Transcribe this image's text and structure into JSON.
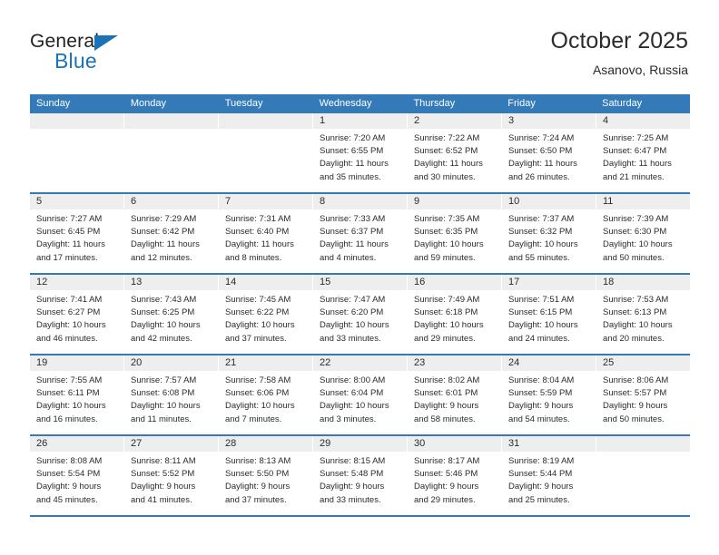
{
  "logo": {
    "word_top": "General",
    "word_bottom": "Blue",
    "accent_color": "#1b72b8"
  },
  "header": {
    "title": "October 2025",
    "subtitle": "Asanovo, Russia"
  },
  "theme": {
    "header_blue": "#3479b8",
    "day_strip_gray": "#eeeeee",
    "text_color": "#2b2b2b"
  },
  "calendar": {
    "weekdays": [
      "Sunday",
      "Monday",
      "Tuesday",
      "Wednesday",
      "Thursday",
      "Friday",
      "Saturday"
    ],
    "weeks": [
      [
        {
          "day": "",
          "empty": true,
          "lines": []
        },
        {
          "day": "",
          "empty": true,
          "lines": []
        },
        {
          "day": "",
          "empty": true,
          "lines": []
        },
        {
          "day": "1",
          "empty": false,
          "lines": [
            "Sunrise: 7:20 AM",
            "Sunset: 6:55 PM",
            "Daylight: 11 hours",
            "and 35 minutes."
          ]
        },
        {
          "day": "2",
          "empty": false,
          "lines": [
            "Sunrise: 7:22 AM",
            "Sunset: 6:52 PM",
            "Daylight: 11 hours",
            "and 30 minutes."
          ]
        },
        {
          "day": "3",
          "empty": false,
          "lines": [
            "Sunrise: 7:24 AM",
            "Sunset: 6:50 PM",
            "Daylight: 11 hours",
            "and 26 minutes."
          ]
        },
        {
          "day": "4",
          "empty": false,
          "lines": [
            "Sunrise: 7:25 AM",
            "Sunset: 6:47 PM",
            "Daylight: 11 hours",
            "and 21 minutes."
          ]
        }
      ],
      [
        {
          "day": "5",
          "empty": false,
          "lines": [
            "Sunrise: 7:27 AM",
            "Sunset: 6:45 PM",
            "Daylight: 11 hours",
            "and 17 minutes."
          ]
        },
        {
          "day": "6",
          "empty": false,
          "lines": [
            "Sunrise: 7:29 AM",
            "Sunset: 6:42 PM",
            "Daylight: 11 hours",
            "and 12 minutes."
          ]
        },
        {
          "day": "7",
          "empty": false,
          "lines": [
            "Sunrise: 7:31 AM",
            "Sunset: 6:40 PM",
            "Daylight: 11 hours",
            "and 8 minutes."
          ]
        },
        {
          "day": "8",
          "empty": false,
          "lines": [
            "Sunrise: 7:33 AM",
            "Sunset: 6:37 PM",
            "Daylight: 11 hours",
            "and 4 minutes."
          ]
        },
        {
          "day": "9",
          "empty": false,
          "lines": [
            "Sunrise: 7:35 AM",
            "Sunset: 6:35 PM",
            "Daylight: 10 hours",
            "and 59 minutes."
          ]
        },
        {
          "day": "10",
          "empty": false,
          "lines": [
            "Sunrise: 7:37 AM",
            "Sunset: 6:32 PM",
            "Daylight: 10 hours",
            "and 55 minutes."
          ]
        },
        {
          "day": "11",
          "empty": false,
          "lines": [
            "Sunrise: 7:39 AM",
            "Sunset: 6:30 PM",
            "Daylight: 10 hours",
            "and 50 minutes."
          ]
        }
      ],
      [
        {
          "day": "12",
          "empty": false,
          "lines": [
            "Sunrise: 7:41 AM",
            "Sunset: 6:27 PM",
            "Daylight: 10 hours",
            "and 46 minutes."
          ]
        },
        {
          "day": "13",
          "empty": false,
          "lines": [
            "Sunrise: 7:43 AM",
            "Sunset: 6:25 PM",
            "Daylight: 10 hours",
            "and 42 minutes."
          ]
        },
        {
          "day": "14",
          "empty": false,
          "lines": [
            "Sunrise: 7:45 AM",
            "Sunset: 6:22 PM",
            "Daylight: 10 hours",
            "and 37 minutes."
          ]
        },
        {
          "day": "15",
          "empty": false,
          "lines": [
            "Sunrise: 7:47 AM",
            "Sunset: 6:20 PM",
            "Daylight: 10 hours",
            "and 33 minutes."
          ]
        },
        {
          "day": "16",
          "empty": false,
          "lines": [
            "Sunrise: 7:49 AM",
            "Sunset: 6:18 PM",
            "Daylight: 10 hours",
            "and 29 minutes."
          ]
        },
        {
          "day": "17",
          "empty": false,
          "lines": [
            "Sunrise: 7:51 AM",
            "Sunset: 6:15 PM",
            "Daylight: 10 hours",
            "and 24 minutes."
          ]
        },
        {
          "day": "18",
          "empty": false,
          "lines": [
            "Sunrise: 7:53 AM",
            "Sunset: 6:13 PM",
            "Daylight: 10 hours",
            "and 20 minutes."
          ]
        }
      ],
      [
        {
          "day": "19",
          "empty": false,
          "lines": [
            "Sunrise: 7:55 AM",
            "Sunset: 6:11 PM",
            "Daylight: 10 hours",
            "and 16 minutes."
          ]
        },
        {
          "day": "20",
          "empty": false,
          "lines": [
            "Sunrise: 7:57 AM",
            "Sunset: 6:08 PM",
            "Daylight: 10 hours",
            "and 11 minutes."
          ]
        },
        {
          "day": "21",
          "empty": false,
          "lines": [
            "Sunrise: 7:58 AM",
            "Sunset: 6:06 PM",
            "Daylight: 10 hours",
            "and 7 minutes."
          ]
        },
        {
          "day": "22",
          "empty": false,
          "lines": [
            "Sunrise: 8:00 AM",
            "Sunset: 6:04 PM",
            "Daylight: 10 hours",
            "and 3 minutes."
          ]
        },
        {
          "day": "23",
          "empty": false,
          "lines": [
            "Sunrise: 8:02 AM",
            "Sunset: 6:01 PM",
            "Daylight: 9 hours",
            "and 58 minutes."
          ]
        },
        {
          "day": "24",
          "empty": false,
          "lines": [
            "Sunrise: 8:04 AM",
            "Sunset: 5:59 PM",
            "Daylight: 9 hours",
            "and 54 minutes."
          ]
        },
        {
          "day": "25",
          "empty": false,
          "lines": [
            "Sunrise: 8:06 AM",
            "Sunset: 5:57 PM",
            "Daylight: 9 hours",
            "and 50 minutes."
          ]
        }
      ],
      [
        {
          "day": "26",
          "empty": false,
          "lines": [
            "Sunrise: 8:08 AM",
            "Sunset: 5:54 PM",
            "Daylight: 9 hours",
            "and 45 minutes."
          ]
        },
        {
          "day": "27",
          "empty": false,
          "lines": [
            "Sunrise: 8:11 AM",
            "Sunset: 5:52 PM",
            "Daylight: 9 hours",
            "and 41 minutes."
          ]
        },
        {
          "day": "28",
          "empty": false,
          "lines": [
            "Sunrise: 8:13 AM",
            "Sunset: 5:50 PM",
            "Daylight: 9 hours",
            "and 37 minutes."
          ]
        },
        {
          "day": "29",
          "empty": false,
          "lines": [
            "Sunrise: 8:15 AM",
            "Sunset: 5:48 PM",
            "Daylight: 9 hours",
            "and 33 minutes."
          ]
        },
        {
          "day": "30",
          "empty": false,
          "lines": [
            "Sunrise: 8:17 AM",
            "Sunset: 5:46 PM",
            "Daylight: 9 hours",
            "and 29 minutes."
          ]
        },
        {
          "day": "31",
          "empty": false,
          "lines": [
            "Sunrise: 8:19 AM",
            "Sunset: 5:44 PM",
            "Daylight: 9 hours",
            "and 25 minutes."
          ]
        },
        {
          "day": "",
          "empty": true,
          "lines": []
        }
      ]
    ]
  }
}
